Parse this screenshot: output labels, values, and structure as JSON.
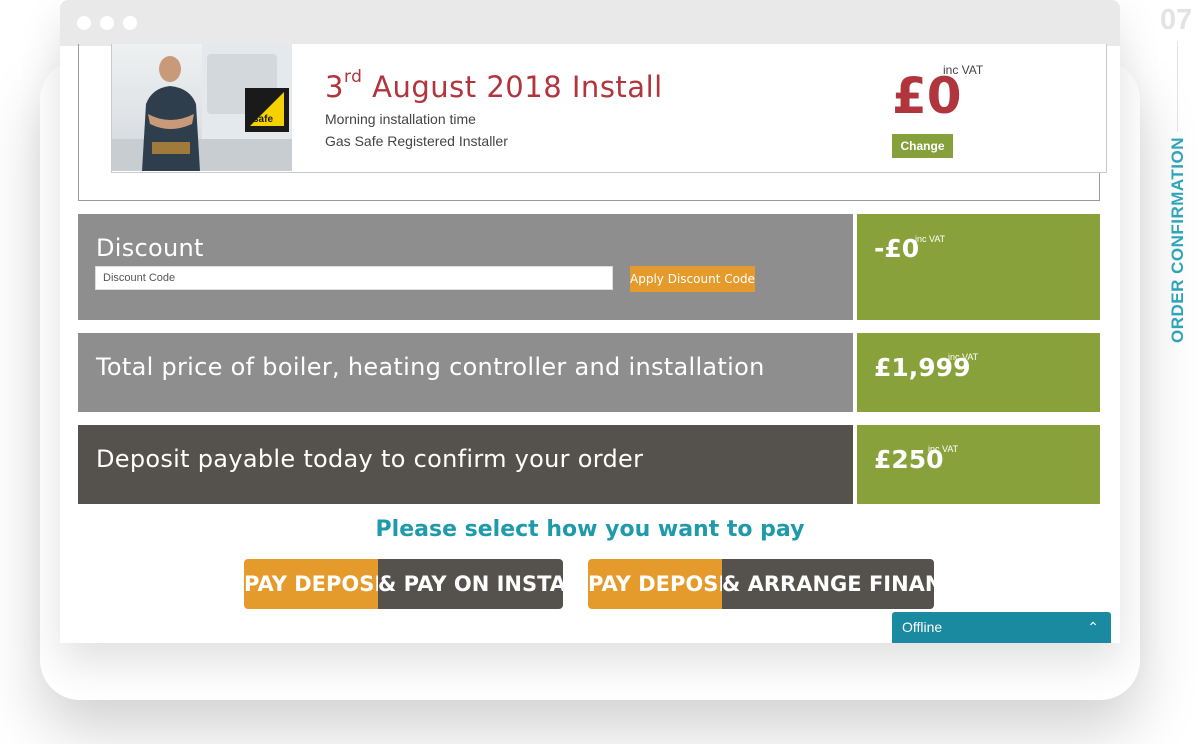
{
  "step": {
    "number": "07",
    "label": "ORDER CONFIRMATION"
  },
  "install": {
    "date_day": "3",
    "date_suffix": "rd",
    "date_rest": " August 2018 Install",
    "time": "Morning installation time",
    "installer": "Gas Safe Registered Installer",
    "price": "£0",
    "vat": "inc VAT",
    "change_label": "Change",
    "badge_text": "safe",
    "badge_small": "Gas"
  },
  "discount": {
    "title": "Discount",
    "placeholder": "Discount Code",
    "apply_label": "Apply Discount Code",
    "price": "-£0",
    "vat": "inc VAT"
  },
  "total": {
    "title": "Total price of boiler, heating controller and installation",
    "price": "£1,999",
    "vat": "inc VAT"
  },
  "deposit": {
    "title": "Deposit payable today to confirm your order",
    "price": "£250",
    "vat": "inc VAT"
  },
  "payment": {
    "heading": "Please select how you want to pay",
    "option1_a": "PAY DEPOSIT",
    "option1_b": "& PAY ON INSTALL",
    "option2_a": "PAY DEPOSIT",
    "option2_b": "& ARRANGE FINANCE"
  },
  "chat": {
    "status": "Offline",
    "chevron": "⌃"
  },
  "colors": {
    "accent_red": "#b0353d",
    "accent_green": "#89a13a",
    "accent_orange": "#e59a2c",
    "accent_teal": "#1f9aaa",
    "row_grey": "#8e8e8e",
    "row_dark": "#55524d"
  }
}
